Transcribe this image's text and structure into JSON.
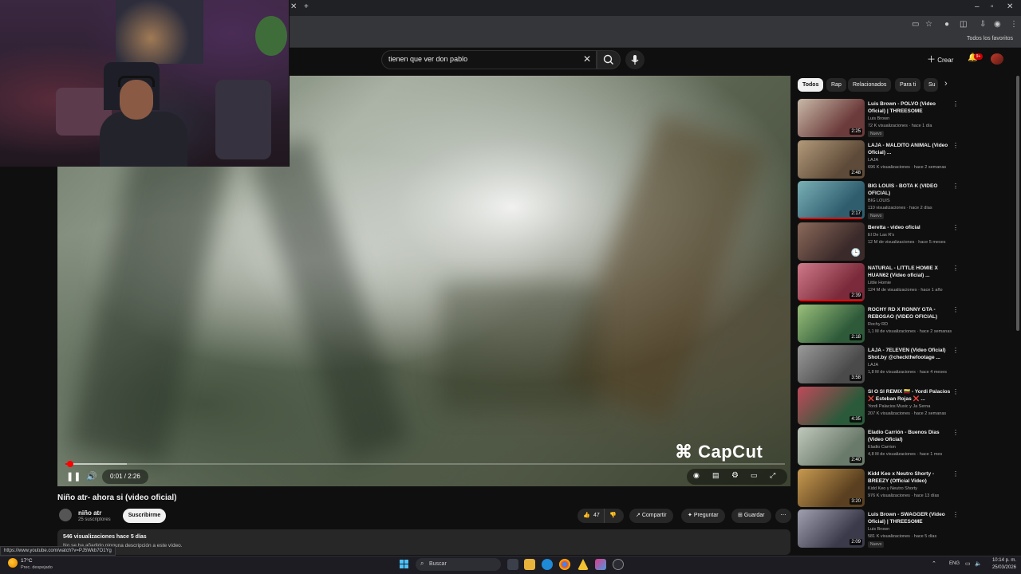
{
  "browser": {
    "bookmarks_label": "Todos los favoritos",
    "status_url": "https://www.youtube.com/watch?v=PJ5Wkb7O1Yg"
  },
  "search": {
    "query": "tienen que ver don pablo"
  },
  "header": {
    "create_label": "Crear",
    "notifications_badge": "9+"
  },
  "player": {
    "time": "0:01 / 2:26",
    "watermark": "CapCut",
    "progress_fraction": 0.007,
    "buffered_fraction": 0.085
  },
  "video": {
    "title": "Niño atr- ahora si   (video oficial)",
    "channel": "niño atr",
    "subscribers": "25 suscriptores",
    "subscribe_label": "Suscribirme",
    "likes": "47",
    "share_label": "Compartir",
    "ask_label": "Preguntar",
    "save_label": "Guardar",
    "views_line": "546 visualizaciones  hace 5 días",
    "description": "No se ha añadido ninguna descripción a este vídeo."
  },
  "chips": [
    "Todos",
    "Rap",
    "Relacionados",
    "Para ti",
    "Su"
  ],
  "recommendations": [
    {
      "title": "Luis Brown - POLVO (Video Oficial) | THREESOME",
      "channel": "Luis Brown",
      "meta": "72 K visualizaciones · hace 1 día",
      "duration": "2:25",
      "badge": "Nuevo",
      "color1": "#6b3a3a",
      "color2": "#c9b9a8"
    },
    {
      "title": "LAJA - MALDITO ANIMAL (Video Oficial) ...",
      "channel": "LAJA",
      "meta": "696 K visualizaciones · hace 2 semanas",
      "duration": "2:48",
      "badge": "",
      "color1": "#5e4a38",
      "color2": "#b29a7a"
    },
    {
      "title": "BIG LOUIS  - BOTA K  (VIDEO OFICIAL)",
      "channel": "BIG LOUIS",
      "meta": "110 visualizaciones · hace 2 días",
      "duration": "2:17",
      "badge": "Nuevo",
      "color1": "#2f5d6e",
      "color2": "#7ab0b6",
      "progress": 0.95
    },
    {
      "title": "Beretta - video oficial",
      "channel": "El De Las R's",
      "meta": "12 M de visualizaciones · hace 5 meses",
      "duration": "",
      "badge": "",
      "color1": "#3b2a2a",
      "color2": "#8c6a5a"
    },
    {
      "title": "NATURAL - LITTLE HOMIE X HUAN62 (Video oficial) ...",
      "channel": "Little Homie",
      "meta": "124 M de visualizaciones · hace 1 año",
      "duration": "2:39",
      "badge": "",
      "color1": "#7a2a3a",
      "color2": "#d07a8a",
      "progress": 0.98
    },
    {
      "title": "ROCHY RD X RONNY GTA - REBOSAO (VIDEO OFICIAL)",
      "channel": "Rochy RD",
      "meta": "1,1 M de visualizaciones · hace 2 semanas",
      "duration": "2:18",
      "badge": "",
      "color1": "#2e5a3a",
      "color2": "#9ac07a"
    },
    {
      "title": "LAJA - 7ELEVEN (Video Oficial) Shot.by @checkthefootage ...",
      "channel": "LAJA",
      "meta": "1,8 M de visualizaciones · hace 4 meses",
      "duration": "3:58",
      "badge": "",
      "color1": "#4a4a4a",
      "color2": "#9a9a9a"
    },
    {
      "title": "SI O SI REMIX 🇨🇴 - Yordi Palacios ❌ Esteban Rojas ❌ ...",
      "channel": "Yordi Palacios Music y Ja Serna",
      "meta": "207 K visualizaciones · hace 2 semanas",
      "duration": "4:35",
      "badge": "",
      "color1": "#2a5a3a",
      "color2": "#c04a5a"
    },
    {
      "title": "Eladio Carrión - Buenos Días (Video Oficial)",
      "channel": "Eladio Carrion",
      "meta": "4,8 M de visualizaciones · hace 1 mes",
      "duration": "2:40",
      "badge": "",
      "color1": "#6a7a6a",
      "color2": "#c0c8bc"
    },
    {
      "title": "Kidd Keo x Neutro Shorty - BREEZY (Official Video)",
      "channel": "Kidd Keo  y Neutro Shorty",
      "meta": "976 K visualizaciones · hace 13 días",
      "duration": "3:20",
      "badge": "",
      "color1": "#5a4020",
      "color2": "#c89a50"
    },
    {
      "title": "Luis Brown - SWAGGER (Video Oficial) | THREESOME",
      "channel": "Luis Brown",
      "meta": "581 K visualizaciones · hace 5 días",
      "duration": "2:09",
      "badge": "Nuevo",
      "color1": "#3a3a4a",
      "color2": "#a0a0b0"
    }
  ],
  "taskbar": {
    "weather_temp": "17°C",
    "weather_desc": "Prec. despejado",
    "search_label": "Buscar",
    "language": "ENG",
    "time": "10:14 p. m.",
    "date": "25/03/2026"
  }
}
